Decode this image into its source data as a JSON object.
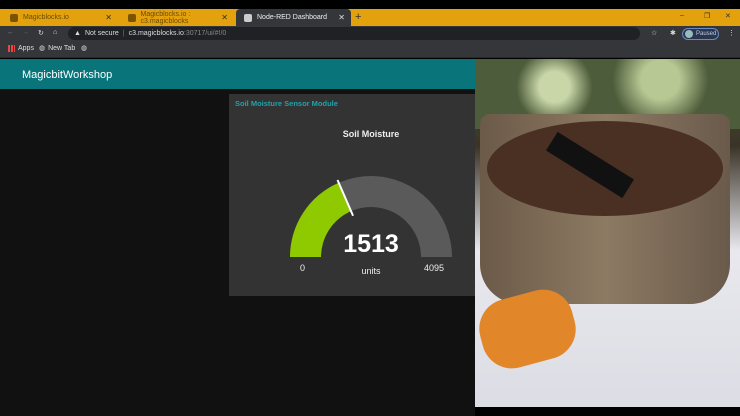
{
  "browser": {
    "tabs": [
      {
        "label": "Magicblocks.io",
        "active": false
      },
      {
        "label": "Magicblocks.io : c3.magicblocks",
        "active": false
      },
      {
        "label": "Node-RED Dashboard",
        "active": true
      }
    ],
    "security": "Not secure",
    "url_host": "c3.magicblocks.io",
    "url_path": ":30717/ui/#!/0",
    "profile": "Paused",
    "bookmarks": [
      {
        "label": "Apps"
      },
      {
        "label": "New Tab"
      }
    ],
    "accent": "#e3a10d"
  },
  "dashboard": {
    "title": "MagicbitWorkshop",
    "header_color": "#097479",
    "group_title": "Soil Moisture Sensor Module",
    "gauge": {
      "label": "Soil Moisture",
      "value": 1513,
      "value_text": "1513",
      "units": "units",
      "min": 0,
      "max": 4095,
      "min_text": "0",
      "max_text": "4095",
      "fill_color": "#8fc900",
      "track_color": "#5a5a5a"
    }
  }
}
